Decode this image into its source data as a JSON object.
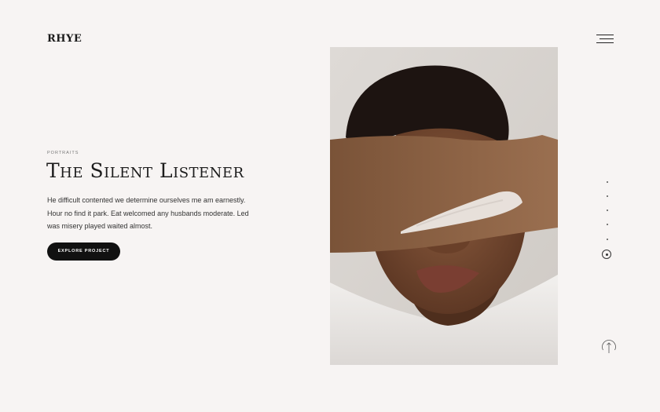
{
  "brand": {
    "logo_text": "RHYE"
  },
  "header": {
    "menu_icon": "hamburger-menu-icon"
  },
  "hero": {
    "category": "PORTRAITS",
    "title": "The Silent Listener",
    "description": "He difficult contented we determine ourselves me am earnestly. Hour no find it park. Eat welcomed any husbands moderate. Led was misery played waited almost.",
    "cta_label": "EXPLORE PROJECT"
  },
  "pagination": {
    "total": 6,
    "active_index": 5
  },
  "scroll_top": {
    "icon": "arrow-up-circle-icon"
  },
  "colors": {
    "background": "#f7f4f3",
    "text": "#1c1c1c",
    "button": "#111111",
    "button_text": "#ffffff"
  }
}
